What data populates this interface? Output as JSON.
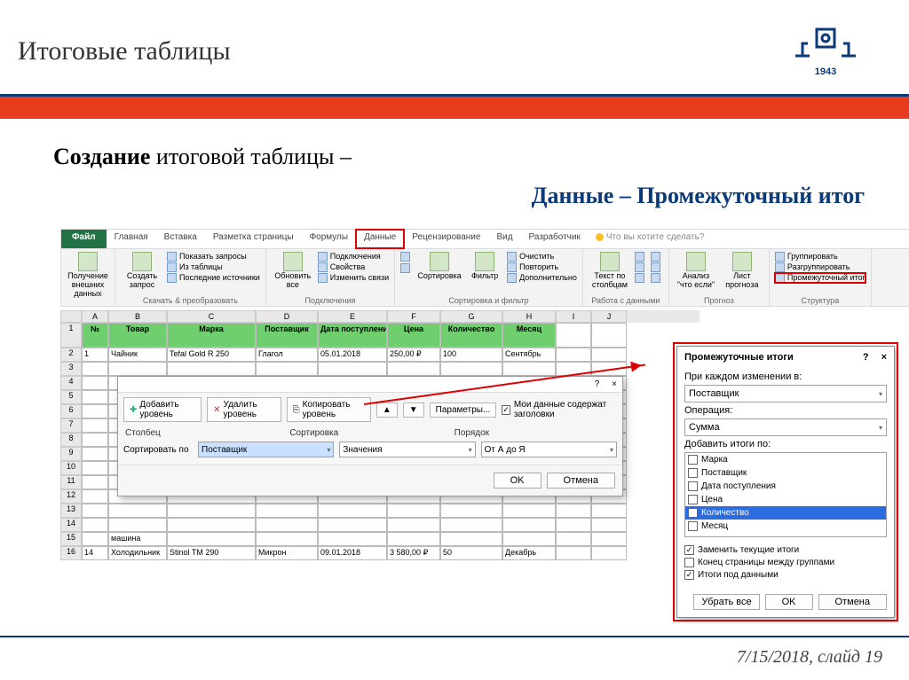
{
  "title": "Итоговые таблицы",
  "logo_year": "1943",
  "line1_bold": "Создание",
  "line1_rest": " итоговой таблицы –",
  "line2": "Данные – Промежуточный итог",
  "footer": "7/15/2018, слайд 19",
  "tabs": {
    "file": "Файл",
    "home": "Главная",
    "insert": "Вставка",
    "layout": "Разметка страницы",
    "formulas": "Формулы",
    "data": "Данные",
    "review": "Рецензирование",
    "view": "Вид",
    "dev": "Разработчик",
    "tellme": "Что вы хотите сделать?"
  },
  "ribbon": {
    "g1": {
      "btn1": "Получение внешних данных",
      "label": ""
    },
    "g2": {
      "btn": "Создать запрос",
      "s1": "Показать запросы",
      "s2": "Из таблицы",
      "s3": "Последние источники",
      "label": "Скачать & преобразовать"
    },
    "g3": {
      "btn": "Обновить все",
      "s1": "Подключения",
      "s2": "Свойства",
      "s3": "Изменить связи",
      "label": "Подключения"
    },
    "g4": {
      "b1": "A↓",
      "b2": "Я↑",
      "b3": "Сортировка",
      "b4": "Фильтр",
      "s1": "Очистить",
      "s2": "Повторить",
      "s3": "Дополнительно",
      "label": "Сортировка и фильтр"
    },
    "g5": {
      "btn": "Текст по столбцам",
      "label": "Работа с данными"
    },
    "g6": {
      "b1": "Анализ \"что если\"",
      "b2": "Лист прогноза",
      "label": "Прогноз"
    },
    "g7": {
      "s1": "Группировать",
      "s2": "Разгруппировать",
      "s3": "Промежуточный итог",
      "label": "Структура"
    }
  },
  "cols": [
    "",
    "A",
    "B",
    "C",
    "D",
    "E",
    "F",
    "G",
    "H",
    "I",
    "J"
  ],
  "headers": [
    "№",
    "Товар",
    "Марка",
    "Поставщик",
    "Дата поступления",
    "Цена",
    "Количество",
    "Месяц"
  ],
  "row2": [
    "1",
    "Чайник",
    "Tefal Gold R 250",
    "Глагол",
    "05.01.2018",
    "250,00 ₽",
    "100",
    "Сентябрь"
  ],
  "row15": [
    "",
    "машина",
    "",
    "",
    "",
    "",
    "",
    ""
  ],
  "row16": [
    "14",
    "Холодильник",
    "Stinol TM 290",
    "Микрон",
    "09.01.2018",
    "3 580,00 ₽",
    "50",
    "Декабрь"
  ],
  "sort": {
    "title_help": "?",
    "title_close": "×",
    "add": "Добавить уровень",
    "del": "Удалить уровень",
    "copy": "Копировать уровень",
    "params": "Параметры...",
    "chk": "Мои данные содержат заголовки",
    "h1": "Столбец",
    "h2": "Сортировка",
    "h3": "Порядок",
    "lbl": "Сортировать по",
    "v1": "Поставщик",
    "v2": "Значения",
    "v3": "От А до Я",
    "ok": "OK",
    "cancel": "Отмена"
  },
  "sub": {
    "title": "Промежуточные итоги",
    "help": "?",
    "close": "×",
    "l1": "При каждом изменении в:",
    "v1": "Поставщик",
    "l2": "Операция:",
    "v2": "Сумма",
    "l3": "Добавить итоги по:",
    "items": [
      "Марка",
      "Поставщик",
      "Дата поступления",
      "Цена",
      "Количество",
      "Месяц"
    ],
    "checked_index": 4,
    "c1": "Заменить текущие итоги",
    "c2": "Конец страницы между группами",
    "c3": "Итоги под данными",
    "remove": "Убрать все",
    "ok": "OK",
    "cancel": "Отмена"
  }
}
